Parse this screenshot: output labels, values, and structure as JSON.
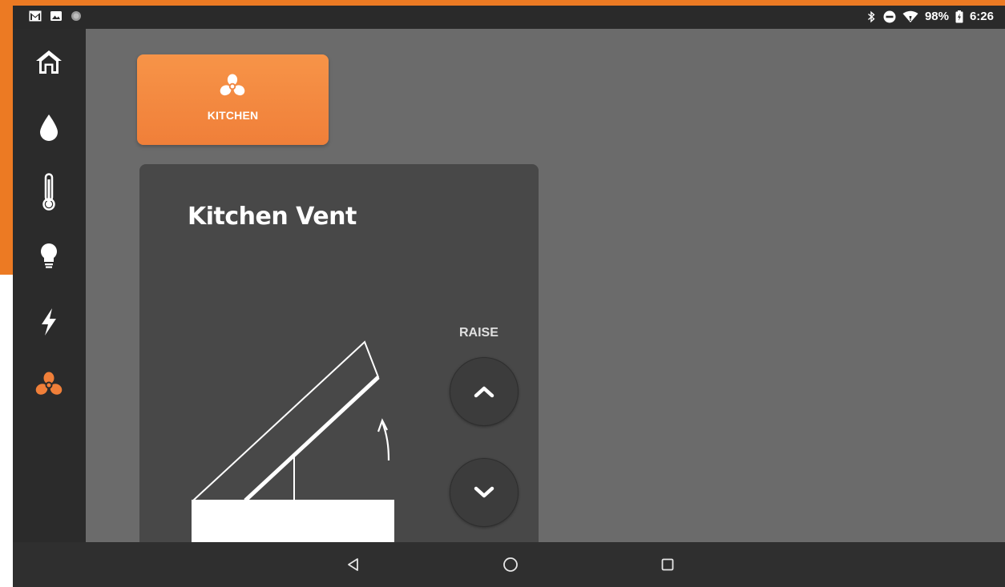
{
  "status_bar": {
    "left_icons": [
      "gmail-icon",
      "photo-icon",
      "notification-dot-icon"
    ],
    "right_icons": [
      "bluetooth-icon",
      "do-not-disturb-icon",
      "wifi-icon",
      "battery-charging-icon"
    ],
    "battery": "98%",
    "time": "6:26"
  },
  "sidebar": {
    "items": [
      {
        "name": "home",
        "icon": "home-icon",
        "active": false
      },
      {
        "name": "water",
        "icon": "water-drop-icon",
        "active": false
      },
      {
        "name": "temperature",
        "icon": "thermometer-icon",
        "active": false
      },
      {
        "name": "lights",
        "icon": "lightbulb-icon",
        "active": false
      },
      {
        "name": "power",
        "icon": "lightning-icon",
        "active": false
      },
      {
        "name": "fans",
        "icon": "fan-icon",
        "active": true
      }
    ]
  },
  "colors": {
    "accent": "#f07f39",
    "sidebar_bg": "#2b2b2b",
    "content_bg": "#6b6b6b",
    "card_bg": "#484848"
  },
  "tile": {
    "label": "KITCHEN",
    "icon": "fan-icon"
  },
  "vent": {
    "title": "Kitchen Vent",
    "raise_label": "RAISE",
    "raise_icon": "chevron-up-icon",
    "lower_icon": "chevron-down-icon"
  },
  "navbar": {
    "back_icon": "back-triangle-icon",
    "home_icon": "home-circle-icon",
    "recents_icon": "recents-square-icon"
  }
}
